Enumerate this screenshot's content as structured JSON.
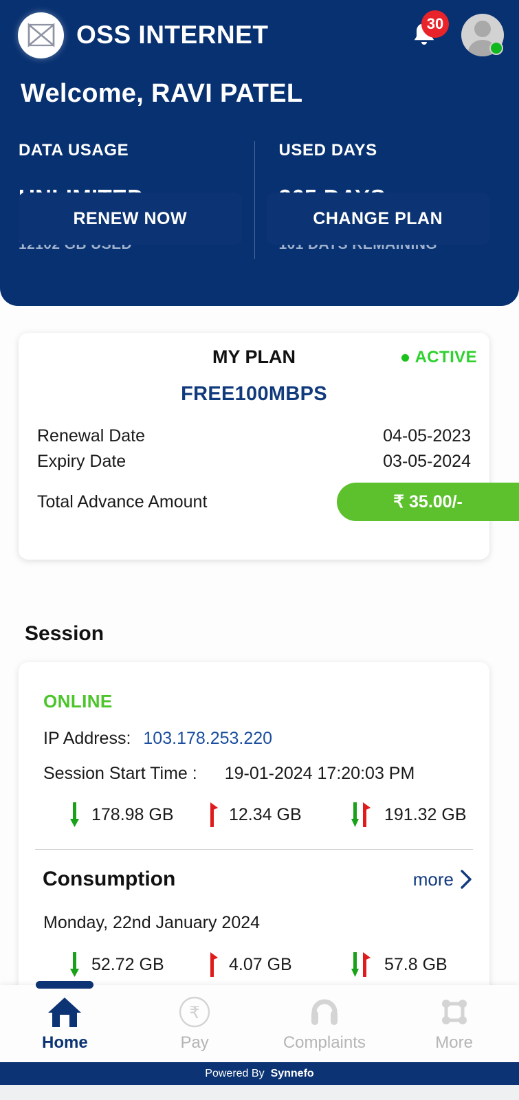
{
  "header": {
    "brand": "OSS INTERNET",
    "logo_icon": "bowtie-logo-icon",
    "notification_icon": "bell-icon",
    "notification_count": "30",
    "avatar_icon": "user-avatar-icon",
    "presence": "online",
    "welcome": "Welcome, RAVI PATEL",
    "stats": [
      {
        "label": "DATA USAGE",
        "value": "UNLIMITED",
        "sub": "12102 GB USED"
      },
      {
        "label": "USED DAYS",
        "value": "365 DAYS",
        "sub": "101 DAYS REMAINING"
      }
    ]
  },
  "plan": {
    "title": "MY PLAN",
    "status": "ACTIVE",
    "status_color": "#2fd12f",
    "name": "FREE100MBPS",
    "renewal_label": "Renewal Date",
    "renewal_value": "04-05-2023",
    "expiry_label": "Expiry Date",
    "expiry_value": "03-05-2024",
    "advance_label": "Total Advance Amount",
    "advance_amount": "₹ 35.00/-",
    "advance_color": "#5cc12c",
    "renew_button": "RENEW NOW",
    "change_button": "CHANGE PLAN"
  },
  "session": {
    "section_title": "Session",
    "status": "ONLINE",
    "ip_label": "IP Address:",
    "ip_value": "103.178.253.220",
    "start_label": "Session Start Time :",
    "start_value": "19-01-2024 17:20:03 PM",
    "traffic": {
      "download": "178.98 GB",
      "upload": "12.34 GB",
      "total": "191.32 GB",
      "download_icon": "arrow-down-icon",
      "upload_icon": "arrow-up-icon",
      "total_icon": "arrow-up-down-icon"
    }
  },
  "consumption": {
    "title": "Consumption",
    "more_label": "more",
    "more_icon": "chevron-right-icon",
    "date": "Monday, 22nd January 2024",
    "download": "52.72 GB",
    "upload": "4.07 GB",
    "total": "57.8 GB"
  },
  "nav": {
    "items": [
      {
        "label": "Home",
        "icon": "home-icon",
        "active": true
      },
      {
        "label": "Pay",
        "icon": "rupee-circle-icon",
        "active": false
      },
      {
        "label": "Complaints",
        "icon": "headset-icon",
        "active": false
      },
      {
        "label": "More",
        "icon": "grid-dots-icon",
        "active": false
      }
    ]
  },
  "footer": {
    "powered_by": "Powered By",
    "brand": "Synnefo"
  }
}
